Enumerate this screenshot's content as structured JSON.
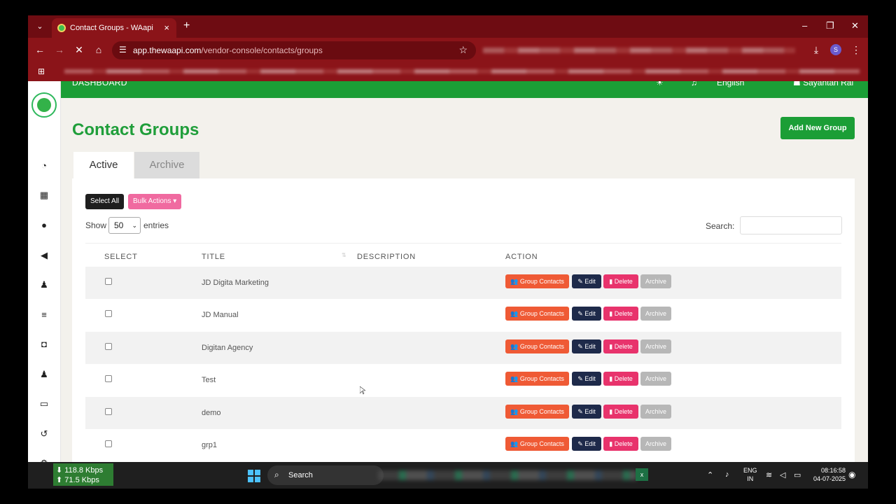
{
  "browser": {
    "tab_title": "Contact Groups - WAapi",
    "tab_close": "×",
    "new_tab": "+",
    "url_host": "app.thewaapi.com",
    "url_path": "/vendor-console/contacts/groups",
    "profile_initial": "S",
    "window_minimize": "–",
    "window_restore": "❐",
    "window_close": "✕"
  },
  "topbar": {
    "dashboard": "DASHBOARD",
    "language": "English",
    "user": "Sayantan Rai"
  },
  "page": {
    "title": "Contact Groups",
    "add_button": "Add New Group",
    "tabs": [
      {
        "label": "Active",
        "selected": true
      },
      {
        "label": "Archive",
        "selected": false
      }
    ],
    "select_all": "Select All",
    "bulk_actions": "Bulk Actions",
    "show_label": "Show",
    "entries_value": "50",
    "entries_label": "entries",
    "search_label": "Search:"
  },
  "table": {
    "columns": [
      "SELECT",
      "TITLE",
      "DESCRIPTION",
      "ACTION"
    ],
    "rows": [
      {
        "title": "JD Digita Marketing",
        "description": ""
      },
      {
        "title": "JD Manual",
        "description": ""
      },
      {
        "title": "Digitan Agency",
        "description": ""
      },
      {
        "title": "Test",
        "description": ""
      },
      {
        "title": "demo",
        "description": ""
      },
      {
        "title": "grp1",
        "description": ""
      }
    ],
    "actions": {
      "group_contacts": "Group Contacts",
      "edit": "Edit",
      "delete": "Delete",
      "archive": "Archive"
    }
  },
  "taskbar": {
    "net_down": "118.8 Kbps",
    "net_up": "71.5 Kbps",
    "search": "Search",
    "lang_top": "ENG",
    "lang_bottom": "IN",
    "time": "08:16:58",
    "date": "04-07-2025"
  },
  "colors": {
    "brand_green": "#1b9e36",
    "browser_red": "#8b1419",
    "group_contacts": "#ef5a35",
    "edit": "#1e2a4a",
    "delete": "#e8336c",
    "archive": "#b7b7b7"
  }
}
